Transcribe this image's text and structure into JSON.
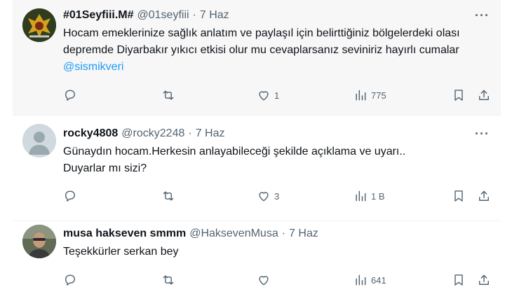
{
  "tweets": [
    {
      "name": "#01Seyfiii.M#",
      "handle": "@01seyfiii",
      "sep": "·",
      "date": "7 Haz",
      "more": "···",
      "text": "Hocam emeklerinize sağlık anlatım ve paylaşıl için belirttiğiniz bölgelerdeki olası depremde Diyarbakır yıkıcı etkisi olur mu cevaplarsanız seviniriz hayırlı cumalar ",
      "mention": "@sismikveri",
      "likes": "1",
      "views": "775"
    },
    {
      "name": "rocky4808",
      "handle": "@rocky2248",
      "sep": "·",
      "date": "7 Haz",
      "more": "···",
      "text_line1": "Günaydın hocam.Herkesin anlayabileceği şekilde açıklama ve uyarı..",
      "text_line2": "Duyarlar mı sizi?",
      "likes": "3",
      "views": "1 B"
    },
    {
      "name": "musa hakseven smmm",
      "handle": "@HaksevenMusa",
      "sep": "·",
      "date": "7 Haz",
      "text": "Teşekkürler serkan bey",
      "views": "641"
    }
  ],
  "icons": [
    "reply-icon",
    "retweet-icon",
    "like-icon",
    "views-icon",
    "bookmark-icon",
    "share-icon"
  ],
  "colors": {
    "link": "#1d9bf0",
    "secondary_text": "#536471",
    "highlight_bg": "#f7f7f8"
  }
}
